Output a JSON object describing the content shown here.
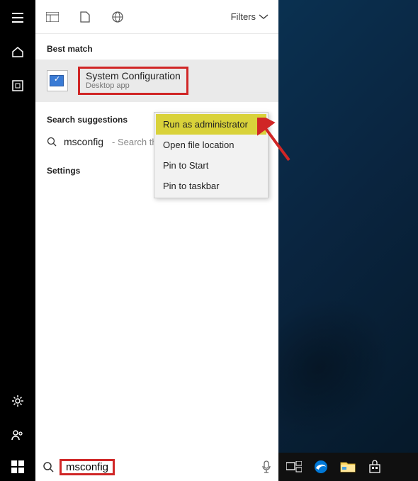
{
  "rail": {
    "items": [
      "menu-icon",
      "home-icon",
      "box-icon"
    ],
    "bottom": [
      "gear-icon",
      "people-icon"
    ]
  },
  "panel": {
    "topFiltersLabel": "Filters",
    "bestMatchLabel": "Best match",
    "bestMatch": {
      "title": "System Configuration",
      "subtitle": "Desktop app"
    },
    "suggestionsLabel": "Search suggestions",
    "suggestion": {
      "query": "msconfig",
      "hint": " - Search th"
    },
    "settingsLabel": "Settings"
  },
  "contextMenu": {
    "items": [
      "Run as administrator",
      "Open file location",
      "Pin to Start",
      "Pin to taskbar"
    ],
    "highlightedIndex": 0
  },
  "taskbar": {
    "searchValue": "msconfig"
  },
  "annotations": {
    "bestMatchBoxColor": "#d02626",
    "searchBoxColor": "#d02626",
    "contextHighlightColor": "#d9d23a",
    "arrowColor": "#d02626"
  }
}
